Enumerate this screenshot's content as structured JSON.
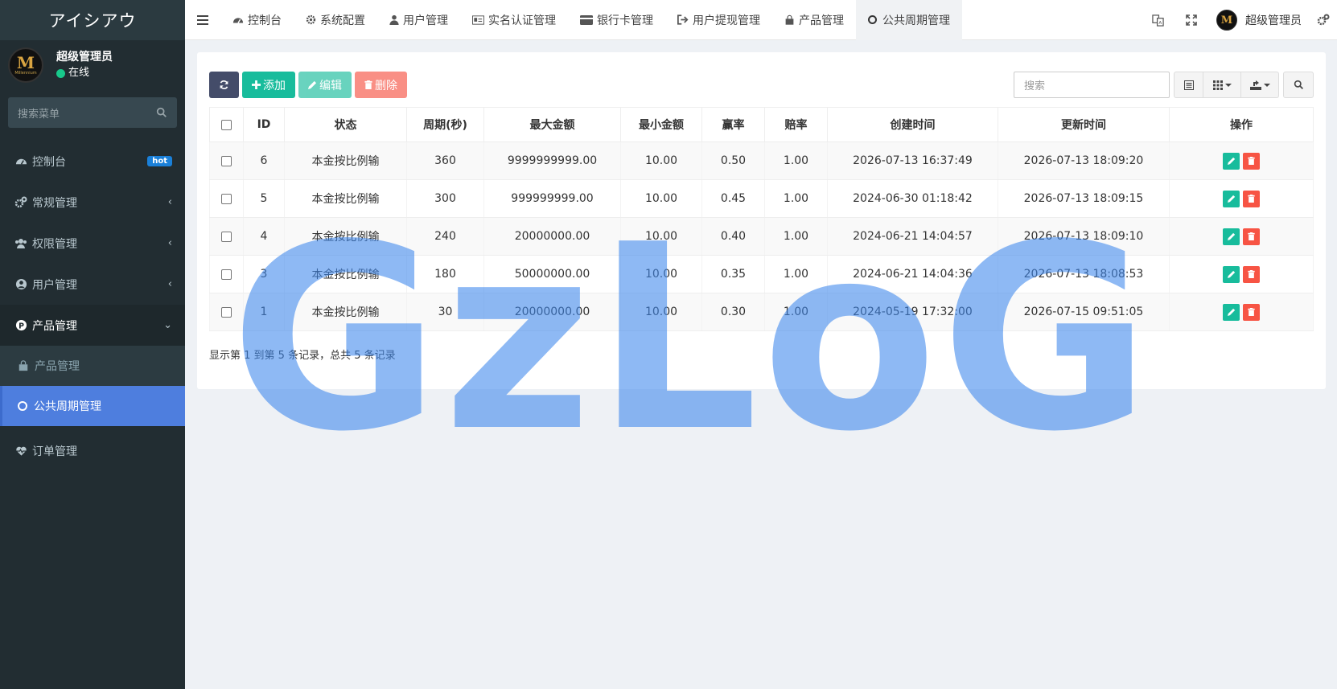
{
  "sidebar": {
    "brand": "アイシアウ",
    "user": {
      "name": "超级管理员",
      "status": "在线",
      "avatar_text": "M",
      "avatar_sub": "Millennium"
    },
    "search_placeholder": "搜索菜单",
    "items": [
      {
        "label": "控制台",
        "badge": "hot",
        "icon": "dashboard-icon"
      },
      {
        "label": "常规管理",
        "icon": "cogs-icon"
      },
      {
        "label": "权限管理",
        "icon": "group-icon"
      },
      {
        "label": "用户管理",
        "icon": "user-circle-icon"
      },
      {
        "label": "产品管理",
        "icon": "product-p-icon"
      },
      {
        "label": "订单管理",
        "icon": "heartbeat-icon"
      }
    ],
    "sub_items": [
      {
        "label": "产品管理",
        "icon": "shopping-bag-icon"
      },
      {
        "label": "公共周期管理",
        "icon": "circle-icon"
      }
    ]
  },
  "topbar": {
    "tabs": [
      {
        "label": "控制台",
        "icon": "dashboard-icon"
      },
      {
        "label": "系统配置",
        "icon": "cog-icon"
      },
      {
        "label": "用户管理",
        "icon": "user-icon"
      },
      {
        "label": "实名认证管理",
        "icon": "id-card-icon"
      },
      {
        "label": "银行卡管理",
        "icon": "credit-card-icon"
      },
      {
        "label": "用户提现管理",
        "icon": "sign-out-icon"
      },
      {
        "label": "产品管理",
        "icon": "shopping-bag-icon"
      },
      {
        "label": "公共周期管理",
        "icon": "circle-icon"
      }
    ],
    "user_name": "超级管理员"
  },
  "toolbar": {
    "add_label": "添加",
    "edit_label": "编辑",
    "delete_label": "删除",
    "search_placeholder": "搜索"
  },
  "table": {
    "headers": [
      "ID",
      "状态",
      "周期(秒)",
      "最大金额",
      "最小金额",
      "赢率",
      "赔率",
      "创建时间",
      "更新时间",
      "操作"
    ],
    "rows": [
      [
        "6",
        "本金按比例输",
        "360",
        "9999999999.00",
        "10.00",
        "0.50",
        "1.00",
        "2026-07-13 16:37:49",
        "2026-07-13 18:09:20"
      ],
      [
        "5",
        "本金按比例输",
        "300",
        "999999999.00",
        "10.00",
        "0.45",
        "1.00",
        "2024-06-30 01:18:42",
        "2026-07-13 18:09:15"
      ],
      [
        "4",
        "本金按比例输",
        "240",
        "20000000.00",
        "10.00",
        "0.40",
        "1.00",
        "2024-06-21 14:04:57",
        "2026-07-13 18:09:10"
      ],
      [
        "3",
        "本金按比例输",
        "180",
        "50000000.00",
        "10.00",
        "0.35",
        "1.00",
        "2024-06-21 14:04:36",
        "2026-07-13 18:08:53"
      ],
      [
        "1",
        "本金按比例输",
        "30",
        "20000000.00",
        "10.00",
        "0.30",
        "1.00",
        "2024-05-19 17:32:00",
        "2026-07-15 09:51:05"
      ]
    ]
  },
  "pagination": {
    "summary": "显示第 1 到第 5 条记录，总共 5 条记录"
  },
  "watermark": "GzLoG",
  "colors": {
    "sidebar_bg": "#222d32",
    "active_item": "#4e7ede",
    "success": "#18bc9c",
    "danger": "#f75444",
    "watermark": "#3c87ec"
  }
}
